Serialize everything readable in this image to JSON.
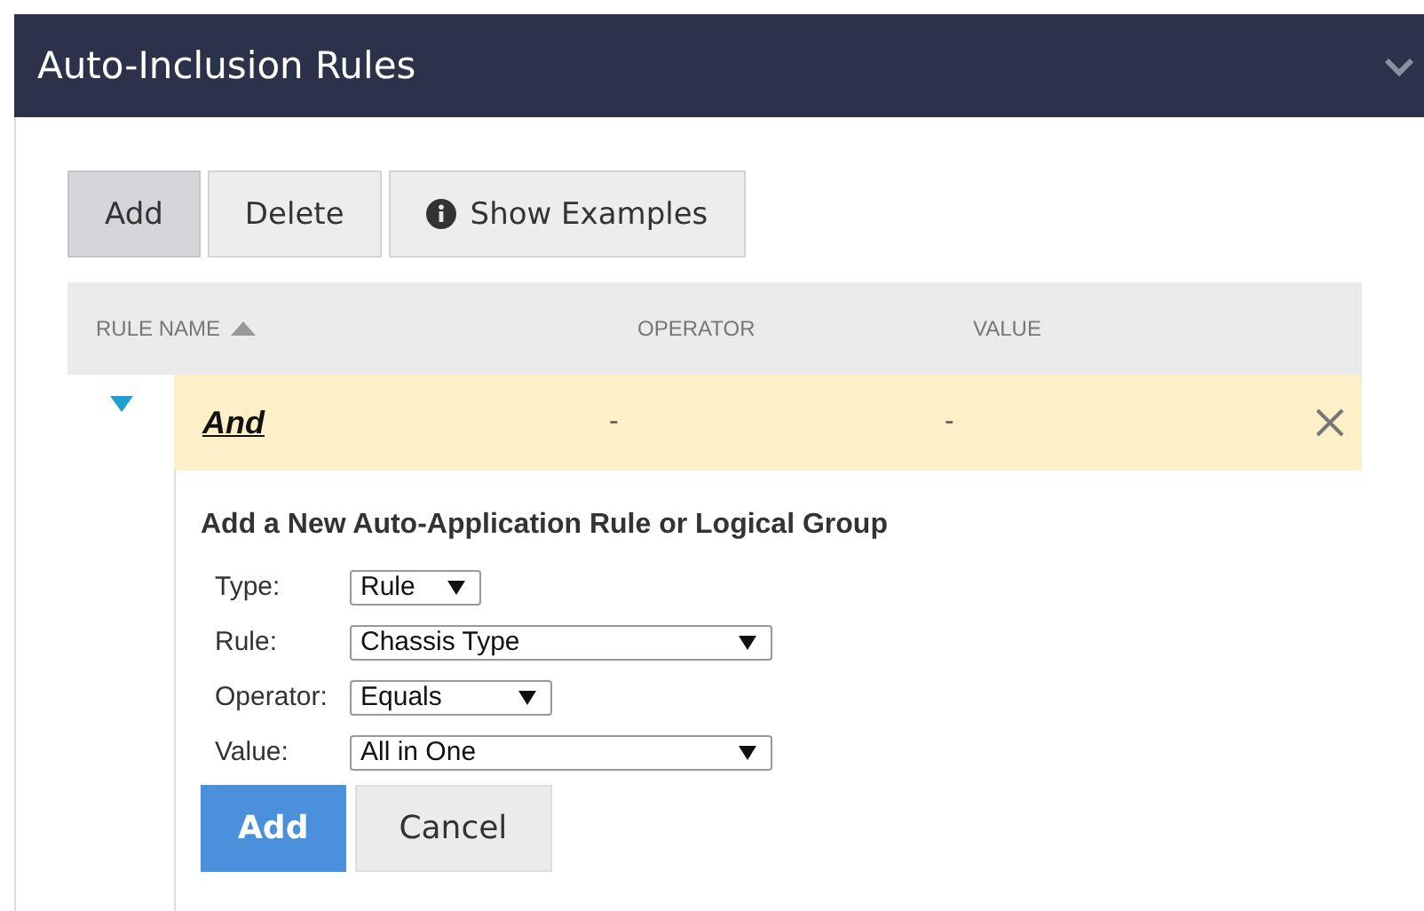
{
  "panel": {
    "title": "Auto-Inclusion Rules",
    "collapsed": false
  },
  "toolbar": [
    {
      "label": "Add",
      "kind": "plain",
      "selected": true
    },
    {
      "label": "Delete",
      "kind": "plain",
      "selected": false
    },
    {
      "label": "Show Examples",
      "kind": "info",
      "selected": false
    }
  ],
  "table": {
    "columns": [
      {
        "label": "RULE NAME",
        "sorted": true
      },
      {
        "label": "OPERATOR",
        "sorted": false
      },
      {
        "label": "VALUE",
        "sorted": false
      }
    ],
    "rows": [
      {
        "expanded": true,
        "cells": [
          "And",
          "-",
          "-"
        ]
      }
    ]
  },
  "form": {
    "title": "Add a New Auto-Application Rule or Logical Group",
    "fields": [
      {
        "label": "Type:",
        "value": "Rule"
      },
      {
        "label": "Rule:",
        "value": "Chassis Type"
      },
      {
        "label": "Operator:",
        "value": "Equals"
      },
      {
        "label": "Value:",
        "value": "All in One"
      }
    ],
    "buttons": [
      {
        "label": "Add",
        "kind": "primary"
      },
      {
        "label": "Cancel",
        "kind": "secondary"
      }
    ]
  }
}
